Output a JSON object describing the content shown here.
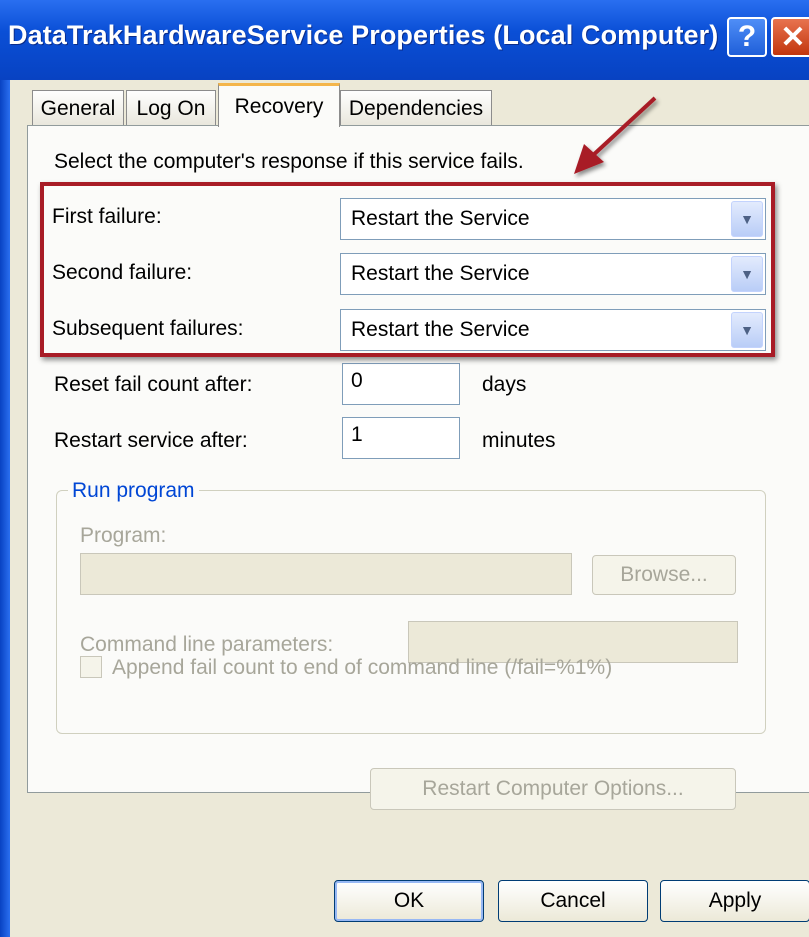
{
  "window": {
    "title": "DataTrakHardwareService Properties (Local Computer)"
  },
  "tabs": [
    {
      "label": "General",
      "active": false
    },
    {
      "label": "Log On",
      "active": false
    },
    {
      "label": "Recovery",
      "active": true
    },
    {
      "label": "Dependencies",
      "active": false
    }
  ],
  "recovery": {
    "intro": "Select the computer's response if this service fails.",
    "failures": [
      {
        "label": "First failure:",
        "action": "Restart the Service"
      },
      {
        "label": "Second failure:",
        "action": "Restart the Service"
      },
      {
        "label": "Subsequent failures:",
        "action": "Restart the Service"
      }
    ],
    "reset": {
      "label": "Reset fail count after:",
      "value": "0",
      "unit": "days"
    },
    "restart": {
      "label": "Restart service after:",
      "value": "1",
      "unit": "minutes"
    }
  },
  "run_program": {
    "group_label": "Run program",
    "program_label": "Program:",
    "program_value": "",
    "browse": "Browse...",
    "params_label": "Command line parameters:",
    "params_value": "",
    "append_label": "Append fail count to end of command line (/fail=%1%)",
    "append_checked": false
  },
  "restart_computer_options": "Restart Computer Options...",
  "buttons": {
    "ok": "OK",
    "cancel": "Cancel",
    "apply": "Apply"
  },
  "icons": {
    "help": "?",
    "close": "✕"
  },
  "colors": {
    "highlight_border": "#a81c26",
    "title_bar": "#0a4fd6"
  }
}
